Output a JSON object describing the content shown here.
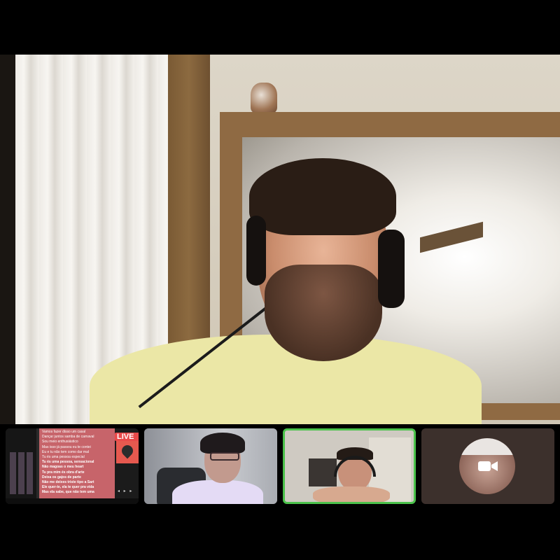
{
  "call": {
    "main_participant": {
      "name": "main-video-participant"
    },
    "screen_share": {
      "live_badge": "LIVE",
      "lyrics": [
        "Vamos fazer disso um casal",
        "Dançar juntos samba de carnaval",
        "Sou meio enthusiástico",
        "Mas isso já passou eu te contei",
        "Eu e tu não tem como dar mal",
        "Tu és uma pessoa especial",
        "Tu és uma pessoa, sensacional",
        "Não magoas o meu heart",
        "Tu pra mim és obra d'arte",
        "Deixa os gajos de parte",
        "Não me deixes triste tipo a Sart",
        "Ele quer-te, ela te quer pra vida",
        "Mas ela sabe, que não tem uma"
      ],
      "bold_from": 6,
      "controls": "◂ ▸ ▸"
    },
    "colors": {
      "active_speaker_border": "#4bc24b",
      "live_badge": "#e94a4a",
      "lyrics_bg": "#c7646a"
    }
  }
}
